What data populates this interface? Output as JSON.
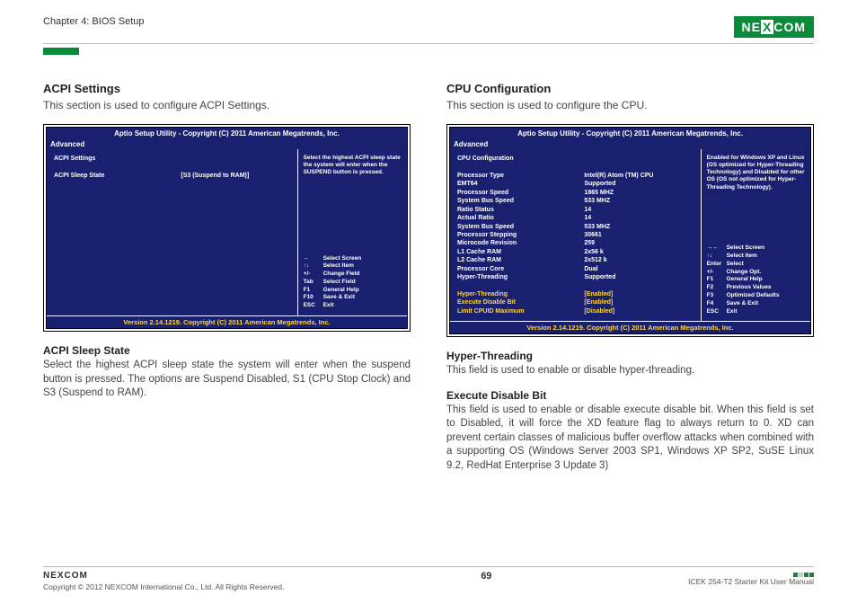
{
  "header": {
    "chapter": "Chapter 4: BIOS Setup",
    "logo_text": "NEXCOM"
  },
  "left": {
    "title": "ACPI Settings",
    "desc": "This section is used to configure ACPI Settings.",
    "bios": {
      "titlebar": "Aptio Setup Utility - Copyright (C) 2011 American Megatrends, Inc.",
      "tab": "Advanced",
      "heading": "ACPI Settings",
      "row1_label": "ACPI Sleep State",
      "row1_value": "[S3 (Suspend to RAM)]",
      "help": "Select the highest ACPI sleep state the system will enter when the SUSPEND button is pressed.",
      "keys": [
        [
          "←",
          "Select Screen"
        ],
        [
          "↑↓",
          "Select Item"
        ],
        [
          "+/-",
          "Change Field"
        ],
        [
          "Tab",
          "Select Field"
        ],
        [
          "F1",
          "General Help"
        ],
        [
          "F10",
          "Save & Exit"
        ],
        [
          "ESC",
          "Exit"
        ]
      ],
      "footer": "Version 2.14.1219. Copyright (C) 2011 American Megatrends, Inc."
    },
    "sub1_title": "ACPI Sleep State",
    "sub1_body": "Select the highest ACPI sleep state the system will enter when the suspend button is pressed. The options are Suspend Disabled, S1 (CPU Stop Clock) and S3 (Suspend to RAM)."
  },
  "right": {
    "title": "CPU Configuration",
    "desc": "This section is used to configure the CPU.",
    "bios": {
      "titlebar": "Aptio Setup Utility - Copyright (C) 2011 American Megatrends, Inc.",
      "tab": "Advanced",
      "heading": "CPU Configuration",
      "rows": [
        [
          "Processor Type",
          "Intel(R) Atom (TM) CPU"
        ],
        [
          "EMT64",
          "Supported"
        ],
        [
          "Processor Speed",
          "1865 MHZ"
        ],
        [
          "System Bus Speed",
          "533 MHZ"
        ],
        [
          "Ratio Status",
          "14"
        ],
        [
          "Actual Ratio",
          "14"
        ],
        [
          "System Bus Speed",
          "533 MHZ"
        ],
        [
          "Processor Stepping",
          "30661"
        ],
        [
          "Microcode Revision",
          "259"
        ],
        [
          "L1 Cache RAM",
          "2x56 k"
        ],
        [
          "L2 Cache RAM",
          "2x512 k"
        ],
        [
          "Processor Core",
          "Dual"
        ],
        [
          "Hyper-Threading",
          "Supported"
        ]
      ],
      "opt1_label": "Hyper-Threading",
      "opt1_value": "[Enabled]",
      "opt2_label": "Execute Disable Bit",
      "opt2_value": "[Enabled]",
      "opt3_label": "Limit CPUID Maximum",
      "opt3_value": "[Disabled]",
      "help": "Enabled for Windows XP and Linux (OS optimized for Hyper-Threading Technology) and Disabled for other OS (OS not optimized for Hyper-Threading Technology).",
      "keys": [
        [
          "→←",
          "Select Screen"
        ],
        [
          "↑↓",
          "Select Item"
        ],
        [
          "Enter",
          "Select"
        ],
        [
          "+/-",
          "Change Opt."
        ],
        [
          "F1",
          "General Help"
        ],
        [
          "F2",
          "Previous Values"
        ],
        [
          "F3",
          "Optimized Defaults"
        ],
        [
          "F4",
          "Save & Exit"
        ],
        [
          "ESC",
          "Exit"
        ]
      ],
      "footer": "Version 2.14.1219. Copyright (C) 2011 American Megatrends, Inc."
    },
    "sub1_title": "Hyper-Threading",
    "sub1_body": "This field is used to enable or disable hyper-threading.",
    "sub2_title": "Execute Disable Bit",
    "sub2_body": "This field is used to enable or disable execute disable bit. When this field is set to Disabled, it will force the XD feature flag to always return to 0. XD can prevent certain classes of malicious buffer overflow attacks when combined with a supporting OS (Windows Server 2003 SP1, Windows XP SP2, SuSE Linux 9.2, RedHat Enterprise 3 Update 3)"
  },
  "footer": {
    "logo": "NEXCOM",
    "copyright": "Copyright © 2012 NEXCOM International Co., Ltd. All Rights Reserved.",
    "page": "69",
    "manual": "ICEK 254-T2 Starter Kit User Manual"
  }
}
